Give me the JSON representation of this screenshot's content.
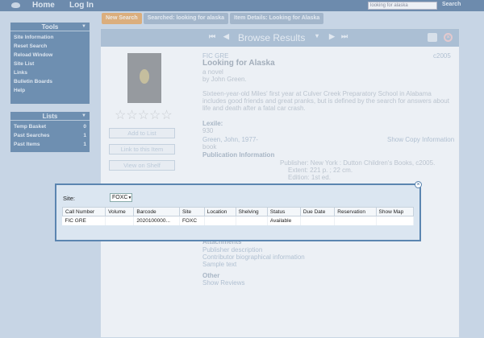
{
  "topbar": {
    "home_label": "Home",
    "login_label": "Log In",
    "search_value": "looking for alaska",
    "search_button": "Search"
  },
  "breadcrumb": [
    "New Search",
    "Searched: looking for alaska",
    "Item Details: Looking for Alaska"
  ],
  "sidebar": {
    "tools_title": "Tools",
    "tools": [
      "Site Information",
      "Reset Search",
      "Reload Window",
      "Site List",
      "Links",
      "Bulletin Boards",
      "Help"
    ],
    "lists_title": "Lists",
    "lists": [
      {
        "label": "Temp Basket",
        "count": "0"
      },
      {
        "label": "Past Searches",
        "count": "1"
      },
      {
        "label": "Past Items",
        "count": "1"
      }
    ]
  },
  "main": {
    "title": "Browse Results",
    "buttons": [
      "Add to List",
      "Link to this Item",
      "View on Shelf"
    ],
    "call_number": "FIC GRE",
    "year": "c2005",
    "book_title": "Looking for Alaska",
    "subtitle": "a novel",
    "byline": "by John Green.",
    "description": "Sixteen-year-old Miles' first year at Culver Creek Preparatory School in Alabama includes good friends and great pranks, but is defined by the search for answers about life and death after a fatal car crash.",
    "lexile_label": "Lexile:",
    "lexile_value": "930",
    "author_line": "Green, John, 1977-",
    "copy_info_link": "Show Copy Information",
    "format": "book",
    "pubinfo_title": "Publication Information",
    "publisher_line": "Publisher: New York : Dutton Children's Books, c2005.",
    "extent_line": "Extent: 221 p. ; 22 cm.",
    "edition_line": "Edition: 1st ed.",
    "attachments_label": "Attachments",
    "links": [
      "Publisher description",
      "Contributor biographical information",
      "Sample text"
    ],
    "other_label": "Other",
    "reviews_link": "Show Reviews"
  },
  "popup": {
    "site_label": "Site:",
    "site_value": "FOXC",
    "columns": [
      "Call Number",
      "Volume",
      "Barcode",
      "Site",
      "Location",
      "Shelving",
      "Status",
      "Due Date",
      "Reservation",
      "Show Map"
    ],
    "rows": [
      {
        "call_number": "FIC GRE",
        "volume": "",
        "barcode": "2020100000...",
        "site": "FOXC",
        "location": "",
        "shelving": "",
        "status": "Available",
        "due_date": "",
        "reservation": "",
        "show_map": ""
      }
    ]
  }
}
